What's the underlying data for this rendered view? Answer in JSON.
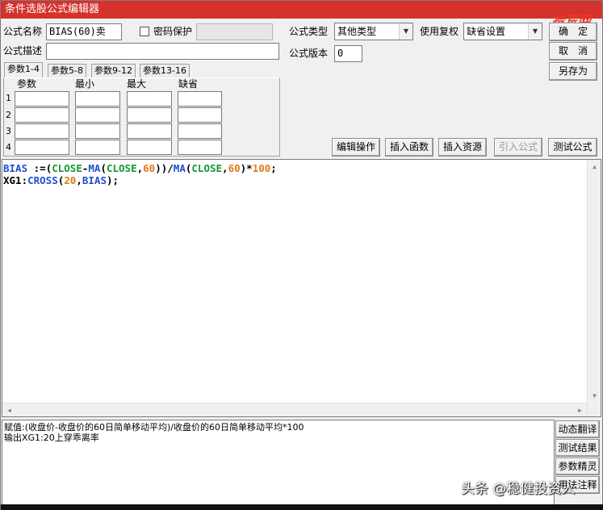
{
  "window": {
    "title": "条件选股公式编辑器",
    "watermark_top": "拾荒网"
  },
  "form": {
    "name_label": "公式名称",
    "name_value": "BIAS(60)卖",
    "password_label": "密码保护",
    "desc_label": "公式描述",
    "desc_value": "",
    "type_label": "公式类型",
    "type_value": "其他类型",
    "restore_label": "使用复权",
    "restore_value": "缺省设置",
    "version_label": "公式版本",
    "version_value": "0"
  },
  "buttons": {
    "ok": "确　定",
    "cancel": "取　消",
    "save_as": "另存为",
    "edit_ops": "编辑操作",
    "insert_func": "插入函数",
    "insert_res": "插入资源",
    "import_formula": "引入公式",
    "test_formula": "测试公式"
  },
  "tabs": [
    "参数1-4",
    "参数5-8",
    "参数9-12",
    "参数13-16"
  ],
  "param_table": {
    "headers": [
      "参数",
      "最小",
      "最大",
      "缺省"
    ],
    "rows": [
      "1",
      "2",
      "3",
      "4"
    ]
  },
  "code": {
    "line1": [
      {
        "t": "BIAS ",
        "c": "#1f4fd1"
      },
      {
        "t": ":=(",
        "c": "#000000"
      },
      {
        "t": "CLOSE",
        "c": "#119a33"
      },
      {
        "t": "-",
        "c": "#000000"
      },
      {
        "t": "MA",
        "c": "#1f4fd1"
      },
      {
        "t": "(",
        "c": "#000000"
      },
      {
        "t": "CLOSE",
        "c": "#119a33"
      },
      {
        "t": ",",
        "c": "#000000"
      },
      {
        "t": "60",
        "c": "#e07a14"
      },
      {
        "t": "))/",
        "c": "#000000"
      },
      {
        "t": "MA",
        "c": "#1f4fd1"
      },
      {
        "t": "(",
        "c": "#000000"
      },
      {
        "t": "CLOSE",
        "c": "#119a33"
      },
      {
        "t": ",",
        "c": "#000000"
      },
      {
        "t": "60",
        "c": "#e07a14"
      },
      {
        "t": ")*",
        "c": "#000000"
      },
      {
        "t": "100",
        "c": "#e07a14"
      },
      {
        "t": ";",
        "c": "#000000"
      }
    ],
    "line2": [
      {
        "t": "XG1",
        "c": "#000000"
      },
      {
        "t": ":",
        "c": "#000000"
      },
      {
        "t": "CROSS",
        "c": "#1f4fd1"
      },
      {
        "t": "(",
        "c": "#000000"
      },
      {
        "t": "20",
        "c": "#e07a14"
      },
      {
        "t": ",",
        "c": "#000000"
      },
      {
        "t": "BIAS",
        "c": "#1f4fd1"
      },
      {
        "t": ");",
        "c": "#000000"
      }
    ]
  },
  "output": {
    "line1": "赋值:(收盘价-收盘价的60日简单移动平均)/收盘价的60日简单移动平均*100",
    "line2": "输出XG1:20上穿乖离率"
  },
  "side_buttons": [
    "动态翻译",
    "测试结果",
    "参数精灵",
    "用法注释"
  ],
  "watermark_bottom": "头条 @稳健投资人"
}
